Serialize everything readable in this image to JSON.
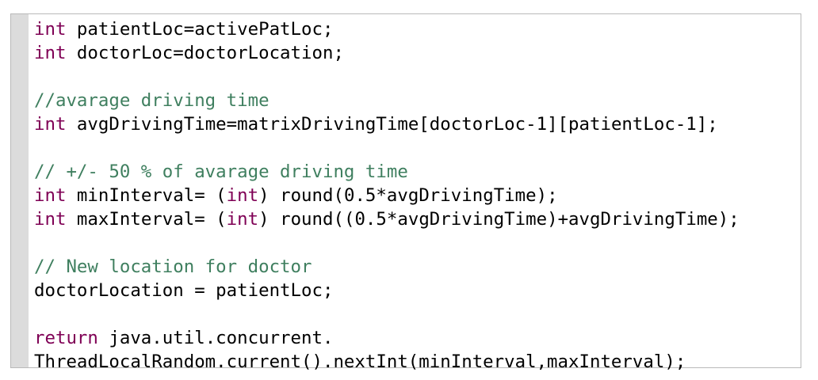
{
  "editor": {
    "lines": [
      [
        {
          "t": "kw",
          "v": "int"
        },
        {
          "t": "tx",
          "v": " patientLoc=activePatLoc;"
        }
      ],
      [
        {
          "t": "kw",
          "v": "int"
        },
        {
          "t": "tx",
          "v": " doctorLoc=doctorLocation;"
        }
      ],
      [],
      [
        {
          "t": "cm",
          "v": "//avarage driving time"
        }
      ],
      [
        {
          "t": "kw",
          "v": "int"
        },
        {
          "t": "tx",
          "v": " avgDrivingTime=matrixDrivingTime[doctorLoc-1][patientLoc-1];"
        }
      ],
      [],
      [
        {
          "t": "cm",
          "v": "// +/- 50 % of avarage driving time"
        }
      ],
      [
        {
          "t": "kw",
          "v": "int"
        },
        {
          "t": "tx",
          "v": " minInterval= ("
        },
        {
          "t": "kw",
          "v": "int"
        },
        {
          "t": "tx",
          "v": ") round(0.5*avgDrivingTime);"
        }
      ],
      [
        {
          "t": "kw",
          "v": "int"
        },
        {
          "t": "tx",
          "v": " maxInterval= ("
        },
        {
          "t": "kw",
          "v": "int"
        },
        {
          "t": "tx",
          "v": ") round((0.5*avgDrivingTime)+avgDrivingTime);"
        }
      ],
      [],
      [
        {
          "t": "cm",
          "v": "// New location for doctor"
        }
      ],
      [
        {
          "t": "tx",
          "v": "doctorLocation = patientLoc;"
        }
      ],
      [],
      [
        {
          "t": "kw",
          "v": "return"
        },
        {
          "t": "tx",
          "v": " java.util.concurrent."
        }
      ],
      [
        {
          "t": "tx",
          "v": "ThreadLocalRandom.current().nextInt(minInterval,maxInterval);"
        }
      ]
    ]
  },
  "colors": {
    "keyword": "#7f0055",
    "comment": "#3f7f5f",
    "text": "#000000",
    "gutter": "#dcdcdc",
    "border": "#b9b9b9"
  }
}
